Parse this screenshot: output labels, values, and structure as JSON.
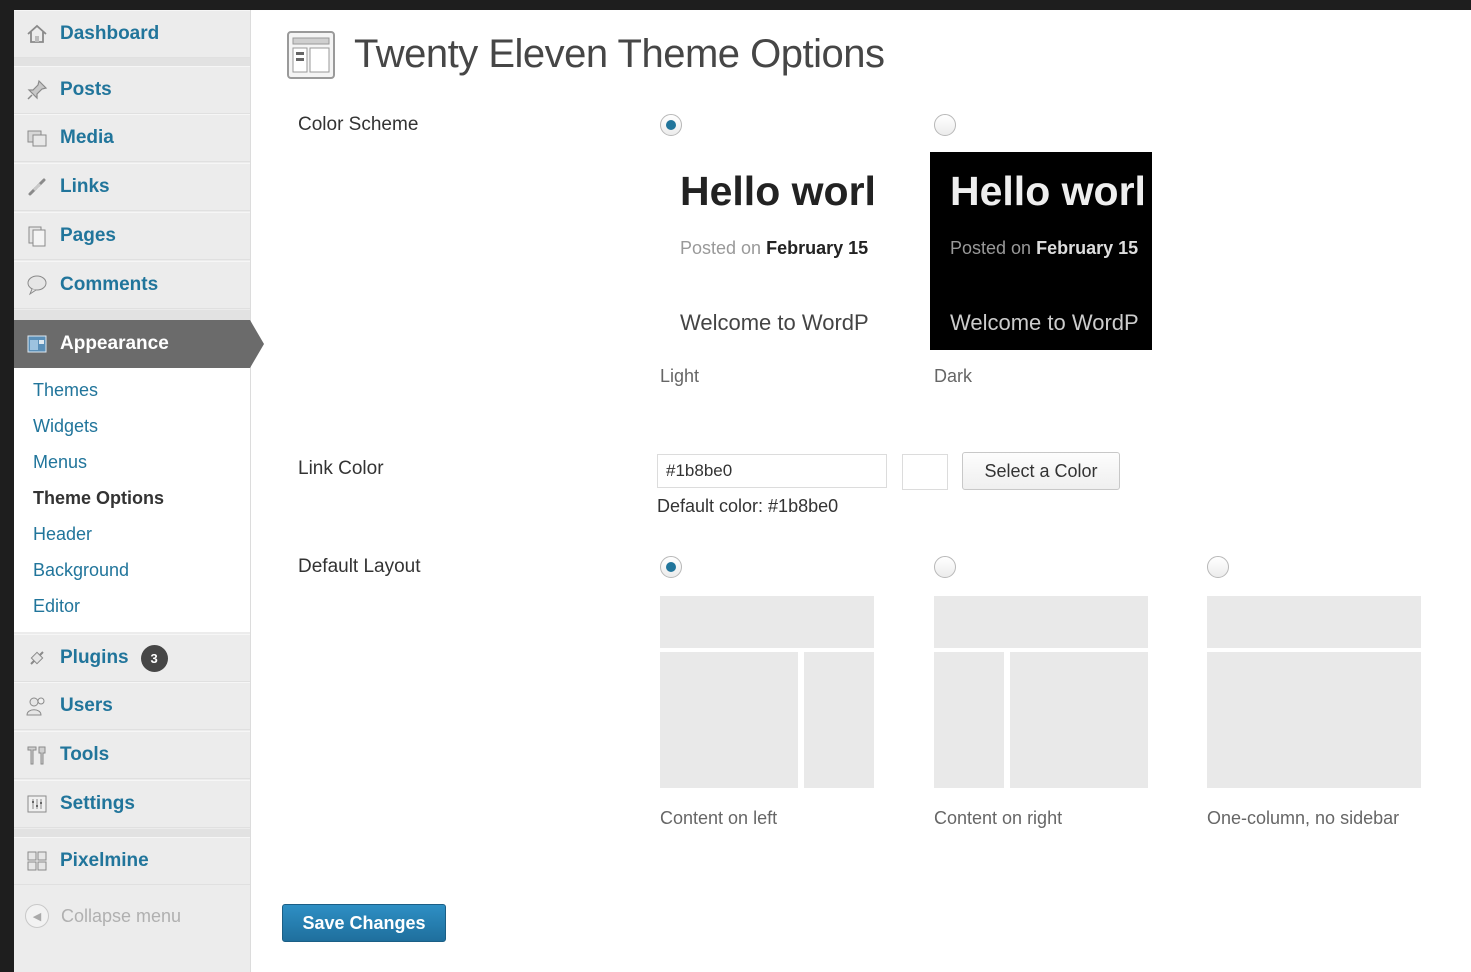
{
  "sidebar": {
    "items": [
      {
        "label": "Dashboard",
        "icon": "home-icon"
      },
      {
        "label": "Posts",
        "icon": "pin-icon"
      },
      {
        "label": "Media",
        "icon": "media-icon"
      },
      {
        "label": "Links",
        "icon": "link-icon"
      },
      {
        "label": "Pages",
        "icon": "pages-icon"
      },
      {
        "label": "Comments",
        "icon": "comment-icon"
      },
      {
        "label": "Appearance",
        "icon": "appearance-icon"
      },
      {
        "label": "Plugins",
        "icon": "plugin-icon",
        "badge": "3"
      },
      {
        "label": "Users",
        "icon": "users-icon"
      },
      {
        "label": "Tools",
        "icon": "tools-icon"
      },
      {
        "label": "Settings",
        "icon": "settings-icon"
      },
      {
        "label": "Pixelmine",
        "icon": "grid-icon"
      }
    ],
    "submenu": [
      "Themes",
      "Widgets",
      "Menus",
      "Theme Options",
      "Header",
      "Background",
      "Editor"
    ],
    "current_submenu": "Theme Options",
    "collapse_label": "Collapse menu"
  },
  "page": {
    "title": "Twenty Eleven Theme Options",
    "color_scheme": {
      "label": "Color Scheme",
      "selected": "Light",
      "options": [
        {
          "caption": "Light",
          "hello": "Hello worl",
          "posted_prefix": "Posted on",
          "posted_date": "February 15",
          "welcome": "Welcome to WordP"
        },
        {
          "caption": "Dark",
          "hello": "Hello worl",
          "posted_prefix": "Posted on",
          "posted_date": "February 15",
          "welcome": "Welcome to WordP"
        }
      ]
    },
    "link_color": {
      "label": "Link Color",
      "value": "#1b8be0",
      "button": "Select a Color",
      "default_text": "Default color: #1b8be0"
    },
    "default_layout": {
      "label": "Default Layout",
      "selected": "Content on left",
      "options": [
        "Content on left",
        "Content on right",
        "One-column, no sidebar"
      ]
    },
    "save_button": "Save Changes"
  },
  "colors": {
    "link": "#21759b",
    "appearance_bg": "#6b6b6b",
    "save_button": "#2785bb"
  }
}
